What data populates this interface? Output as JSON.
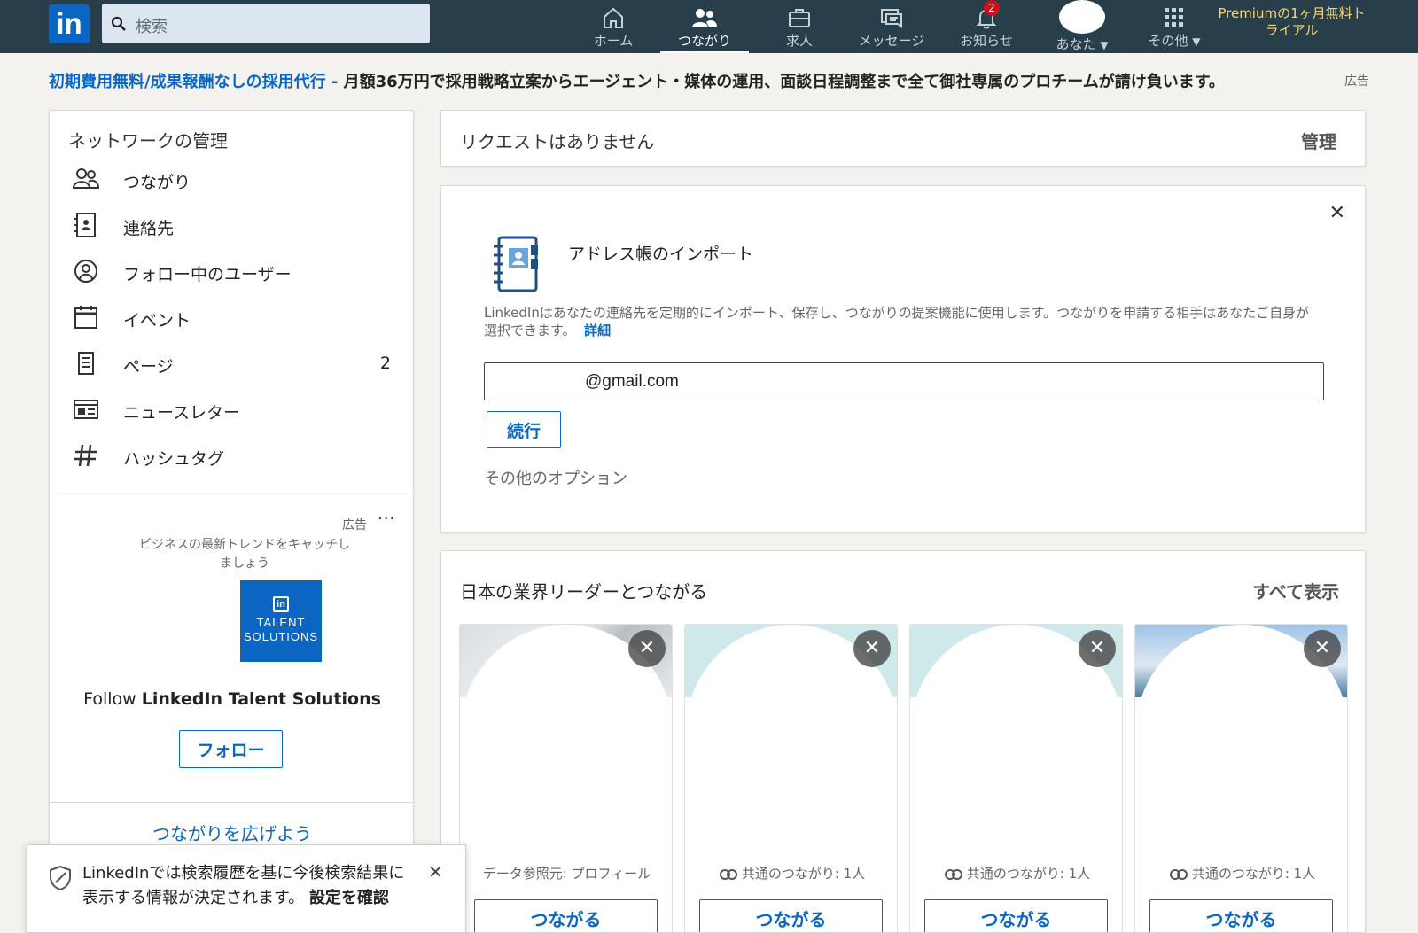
{
  "nav": {
    "search_placeholder": "検索",
    "items": [
      {
        "label": "ホーム",
        "icon": "home-icon"
      },
      {
        "label": "つながり",
        "icon": "network-icon"
      },
      {
        "label": "求人",
        "icon": "briefcase-icon"
      },
      {
        "label": "メッセージ",
        "icon": "messaging-icon"
      },
      {
        "label": "お知らせ",
        "icon": "bell-icon",
        "badge": "2"
      },
      {
        "label": "あなた",
        "icon": "avatar"
      },
      {
        "label": "その他",
        "icon": "grid-icon"
      }
    ],
    "premium": "Premiumの1ヶ月無料トライアル"
  },
  "ad_banner": {
    "link": "初期費用無料/成果報酬なしの採用代行 -",
    "text": " 月額36万円で採用戦略立案からエージェント・媒体の運用、面談日程調整まで全て御社専属のプロチームが請け負います。",
    "tag": "広告"
  },
  "sidebar": {
    "title": "ネットワークの管理",
    "items": [
      {
        "label": "つながり",
        "icon": "people-icon",
        "count": ""
      },
      {
        "label": "連絡先",
        "icon": "contact-book-icon",
        "count": ""
      },
      {
        "label": "フォロー中のユーザー",
        "icon": "person-circle-icon",
        "count": ""
      },
      {
        "label": "イベント",
        "icon": "calendar-icon",
        "count": ""
      },
      {
        "label": "ページ",
        "icon": "building-icon",
        "count": "2"
      },
      {
        "label": "ニュースレター",
        "icon": "newsletter-icon",
        "count": ""
      },
      {
        "label": "ハッシュタグ",
        "icon": "hashtag-icon",
        "count": ""
      }
    ],
    "ad": {
      "tag": "広告",
      "text": "ビジネスの最新トレンドをキャッチしましょう",
      "logo_line1": "TALENT",
      "logo_line2": "SOLUTIONS",
      "follow_prefix": "Follow ",
      "follow_name": "LinkedIn Talent Solutions",
      "follow_button": "フォロー"
    },
    "expand": "つながりを広げよう"
  },
  "toast": {
    "text": "LinkedInでは検索履歴を基に今後検索結果に表示する情報が決定されます。",
    "link": "設定を確認"
  },
  "requests": {
    "text": "リクエストはありません",
    "manage": "管理"
  },
  "import": {
    "title": "アドレス帳のインポート",
    "desc": "LinkedInはあなたの連絡先を定期的にインポート、保存し、つながりの提案機能に使用します。つながりを申請する相手はあなたご自身が選択できます。",
    "more": "詳細",
    "email": "@gmail.com",
    "continue": "続行",
    "other": "その他のオプション"
  },
  "leaders": {
    "title": "日本の業界リーダーとつながる",
    "see_all": "すべて表示",
    "cards": [
      {
        "meta": "データ参照元: プロフィール",
        "rings": false,
        "button": "つながる"
      },
      {
        "meta": "共通のつながり: 1人",
        "rings": true,
        "button": "つながる"
      },
      {
        "meta": "共通のつながり: 1人",
        "rings": true,
        "button": "つながる"
      },
      {
        "meta": "共通のつながり: 1人",
        "rings": true,
        "button": "つながる"
      }
    ]
  },
  "colors": {
    "nav_bg": "#283e4a",
    "brand_blue": "#0a66c2",
    "premium_gold": "#f5d77a",
    "badge_red": "#cc1016"
  }
}
